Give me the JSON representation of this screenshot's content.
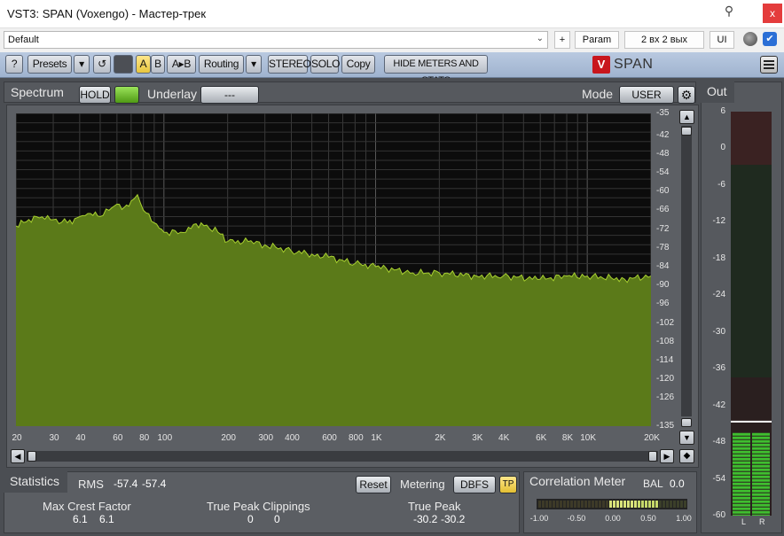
{
  "window": {
    "title": "VST3: SPAN (Voxengo) - Мастер-трек",
    "close_glyph": "x",
    "pin_glyph": "⚲"
  },
  "preset_bar": {
    "preset_value": "Default",
    "plus_label": "+",
    "param_label": "Param",
    "io_label": "2 вх 2 вых",
    "ui_label": "UI",
    "checkbox_glyph": "✔"
  },
  "toolbar": {
    "help_label": "?",
    "presets_label": "Presets",
    "dropdown_glyph": "▾",
    "undo_glyph": "↺",
    "a_label": "A",
    "b_label": "B",
    "ab_label": "A▸B",
    "routing_label": "Routing",
    "stereo_label": "STEREO",
    "solo_label": "SOLO",
    "copy_label": "Copy",
    "hide_meters_label": "HIDE METERS AND STATS",
    "brand_mark": "V",
    "brand_name": "SPAN"
  },
  "spectrum": {
    "title": "Spectrum",
    "hold_label": "HOLD",
    "underlay_label": "Underlay",
    "underlay_value": "---",
    "mode_label": "Mode",
    "mode_value": "USER",
    "gear_glyph": "⚙",
    "fill_color": "#5b7a19",
    "line_color": "#a8d030"
  },
  "chart_data": {
    "type": "area",
    "title": "",
    "xlabel": "",
    "ylabel": "",
    "x_scale": "log",
    "xlim": [
      20,
      20000
    ],
    "ylim": [
      -135,
      -35
    ],
    "x_ticks": [
      "20",
      "30",
      "40",
      "60",
      "80",
      "100",
      "200",
      "300",
      "400",
      "600",
      "800",
      "1K",
      "2K",
      "3K",
      "4K",
      "6K",
      "8K",
      "10K",
      "20K"
    ],
    "y_ticks": [
      "-35",
      "-42",
      "-48",
      "-54",
      "-60",
      "-66",
      "-72",
      "-78",
      "-84",
      "-90",
      "-96",
      "-102",
      "-108",
      "-114",
      "-120",
      "-126",
      "-135"
    ],
    "grid": true,
    "series": [
      {
        "x": [
          20,
          25,
          30,
          35,
          40,
          45,
          50,
          55,
          60,
          65,
          70,
          75,
          80,
          90,
          100,
          120,
          150,
          180,
          200,
          250,
          300,
          400,
          500,
          600,
          800,
          1000,
          1500,
          2000,
          3000,
          4000,
          6000,
          8000,
          10000,
          15000,
          20000
        ],
        "values": [
          -71,
          -68,
          -69,
          -70,
          -68,
          -67,
          -68,
          -66,
          -64,
          -65,
          -63,
          -61,
          -66,
          -70,
          -73,
          -73,
          -70,
          -73,
          -76,
          -76,
          -77,
          -79,
          -80,
          -81,
          -83,
          -84,
          -86,
          -86,
          -87,
          -87,
          -88,
          -87,
          -87,
          -88,
          -87
        ]
      }
    ]
  },
  "statistics": {
    "title": "Statistics",
    "rms_label": "RMS",
    "rms_l": "-57.4",
    "rms_r": "-57.4",
    "reset_label": "Reset",
    "metering_label": "Metering",
    "metering_value": "DBFS",
    "tp_label": "TP",
    "crest_label": "Max Crest Factor",
    "crest_l": "6.1",
    "crest_r": "6.1",
    "clip_label": "True Peak Clippings",
    "clip_l": "0",
    "clip_r": "0",
    "peak_label": "True Peak",
    "peak_l": "-30.2",
    "peak_r": "-30.2"
  },
  "correlation": {
    "title": "Correlation Meter",
    "bal_label": "BAL",
    "bal_value": "0.0",
    "scale": [
      "-1.00",
      "-0.50",
      "0.00",
      "0.50",
      "1.00"
    ]
  },
  "out_meter": {
    "title": "Out",
    "scale": [
      "6",
      "0",
      "-6",
      "-12",
      "-18",
      "-24",
      "-30",
      "-36",
      "-42",
      "-48",
      "-54",
      "-60"
    ],
    "left_label": "L",
    "right_label": "R"
  }
}
